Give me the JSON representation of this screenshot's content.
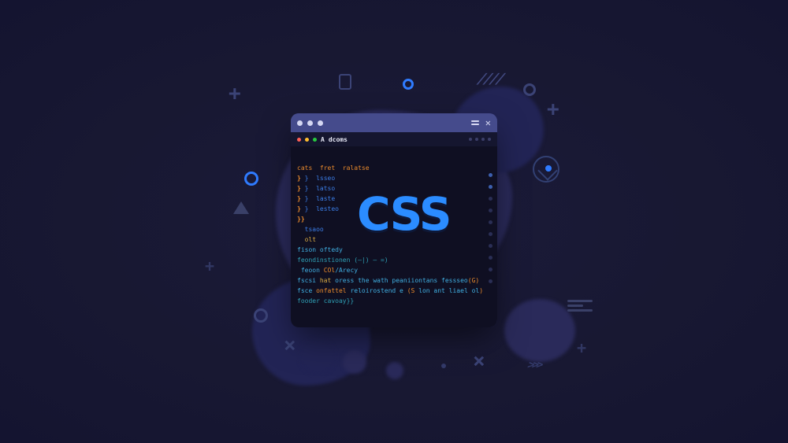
{
  "window": {
    "tab_prefix": "A",
    "tab_name": "dcoms",
    "close_glyph": "✕"
  },
  "logo": "CSS",
  "code": {
    "l1": "cats  fret  ralatse",
    "l2": "}  lsseo",
    "l3": "}  latso",
    "l4": "}  laste",
    "l5": "}  lesteo",
    "l6": "}}",
    "l7": "  tsaoo",
    "l8": "  olt",
    "l9": "fison oftedy",
    "l10": "feondinstionen (—|) — =)",
    "l11": "feoon COl/Arecy",
    "l12": "fscsi hat oress the wath peaniiontans fessseo(G)",
    "l13": "fsce onfattel reloirostend e (S lon ant liael ol)",
    "l14": "fooder cavoay}}"
  }
}
